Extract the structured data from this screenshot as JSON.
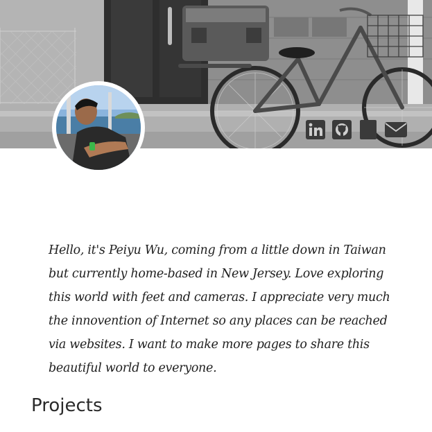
{
  "profile": {
    "bio": "Hello, it's Peiyu Wu, coming from a little down in Taiwan but currently home-based in New Jersey. Love exploring this world with feet and cameras. I appreciate very much the innovention of Internet so any places can be reached via websites. I want to make more pages to share this beautiful world to everyone."
  },
  "social": {
    "icons": [
      "linkedin-icon",
      "github-icon",
      "bookmark-icon",
      "mail-icon"
    ],
    "icon_color": "#3a3a3a"
  },
  "sections": {
    "projects_title": "Projects"
  }
}
